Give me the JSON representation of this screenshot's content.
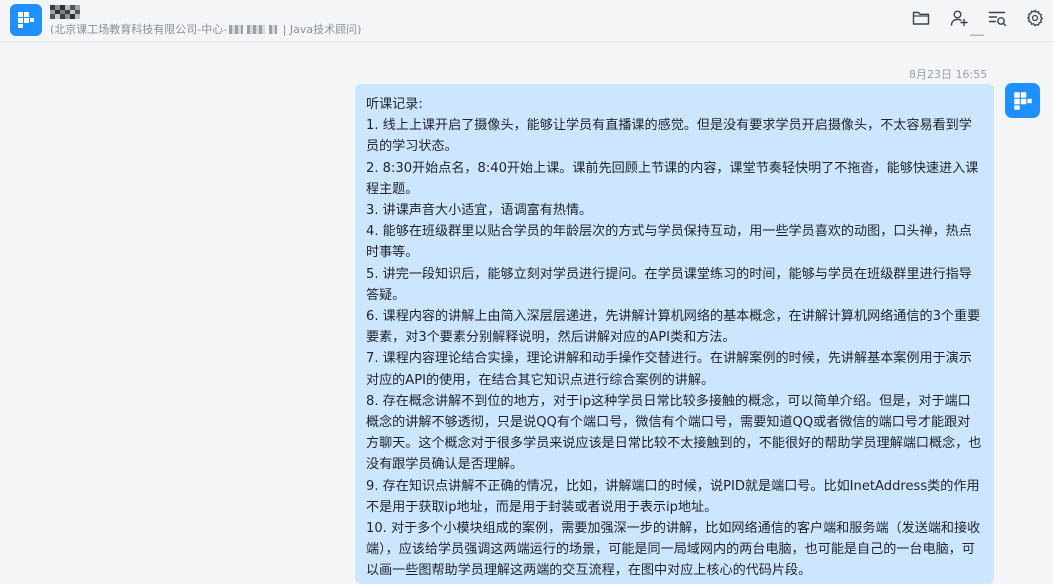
{
  "header": {
    "subtitle_pre": "(北京课工场教育科技有限公司-中心-",
    "subtitle_post": "| Java技术顾问)",
    "icons": [
      "folder-icon",
      "add-user-icon",
      "search-list-icon",
      "settings-gear-icon"
    ]
  },
  "chat": {
    "timestamp": "8月23日 16:55",
    "message": {
      "title": "听课记录:",
      "items": [
        "1. 线上上课开启了摄像头，能够让学员有直播课的感觉。但是没有要求学员开启摄像头，不太容易看到学员的学习状态。",
        "2. 8:30开始点名，8:40开始上课。课前先回顾上节课的内容，课堂节奏轻快明了不拖沓，能够快速进入课程主题。",
        "3. 讲课声音大小适宜，语调富有热情。",
        "4. 能够在班级群里以贴合学员的年龄层次的方式与学员保持互动，用一些学员喜欢的动图，口头禅，热点时事等。",
        "5. 讲完一段知识后，能够立刻对学员进行提问。在学员课堂练习的时间，能够与学员在班级群里进行指导答疑。",
        "6. 课程内容的讲解上由简入深层层递进，先讲解计算机网络的基本概念，在讲解计算机网络通信的3个重要要素，对3个要素分别解释说明，然后讲解对应的API类和方法。",
        "7. 课程内容理论结合实操，理论讲解和动手操作交替进行。在讲解案例的时候，先讲解基本案例用于演示对应的API的使用，在结合其它知识点进行综合案例的讲解。",
        "8. 存在概念讲解不到位的地方，对于ip这种学员日常比较多接触的概念，可以简单介绍。但是，对于端口概念的讲解不够透彻，只是说QQ有个端口号，微信有个端口号，需要知道QQ或者微信的端口号才能跟对方聊天。这个概念对于很多学员来说应该是日常比较不太接触到的，不能很好的帮助学员理解端口概念，也没有跟学员确认是否理解。",
        "9. 存在知识点讲解不正确的情况，比如，讲解端口的时候，说PID就是端口号。比如InetAddress类的作用不是用于获取ip地址，而是用于封装或者说用于表示ip地址。",
        "10. 对于多个小模块组成的案例，需要加强深一步的讲解，比如网络通信的客户端和服务端（发送端和接收端），应该给学员强调这两端运行的场景，可能是同一局域网内的两台电脑，也可能是自己的一台电脑，可以画一些图帮助学员理解这两端的交互流程，在图中对应上核心的代码片段。"
      ]
    }
  },
  "colors": {
    "accent": "#1e90ff",
    "bubble": "#cde6ff",
    "background": "#f4f5f7"
  }
}
